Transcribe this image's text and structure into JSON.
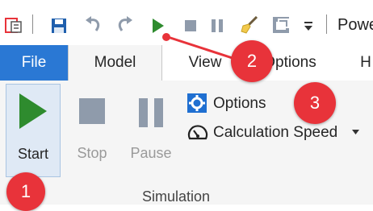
{
  "quick_access": {
    "title_partial": "Powe",
    "icons": [
      "pbix-file-icon",
      "save-icon",
      "undo-icon",
      "redo-icon",
      "play-icon",
      "stop-icon",
      "pause-icon",
      "clear-brush-icon",
      "window-icon",
      "customize-dropdown-icon"
    ]
  },
  "tabs": [
    {
      "label": "File"
    },
    {
      "label": "Model"
    },
    {
      "label": "View"
    },
    {
      "label": "Options"
    },
    {
      "label": "H"
    }
  ],
  "ribbon": {
    "start_label": "Start",
    "stop_label": "Stop",
    "pause_label": "Pause",
    "options_label": "Options",
    "calc_speed_label": "Calculation Speed",
    "group_label": "Simulation"
  },
  "callouts": [
    "1",
    "2",
    "3"
  ],
  "colors": {
    "accent_blue": "#2a78d4",
    "play_green": "#2e8b2e",
    "callout_red": "#e8333a",
    "disabled_gray": "#8f9bab"
  }
}
